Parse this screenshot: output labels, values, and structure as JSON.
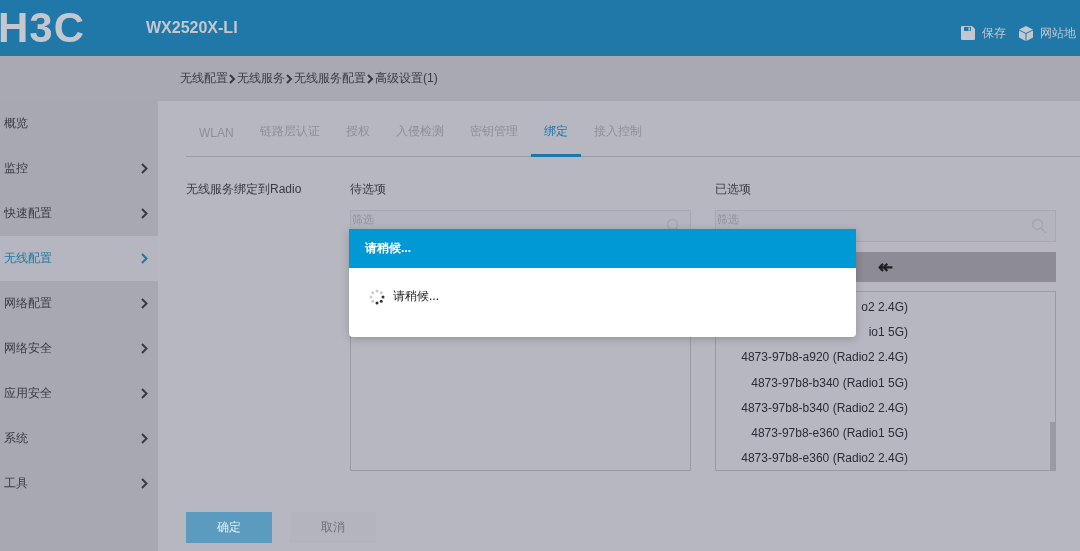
{
  "header": {
    "logo": "H3C",
    "model": "WX2520X-LI",
    "actions": [
      {
        "kind": "save",
        "label": "保存"
      },
      {
        "kind": "sitemap",
        "label": "网站地"
      }
    ]
  },
  "breadcrumb": [
    "无线配置",
    "无线服务",
    "无线服务配置",
    "高级设置(1)"
  ],
  "sidebar": {
    "items": [
      {
        "label": "概览",
        "expandable": false,
        "selected": false
      },
      {
        "label": "监控",
        "expandable": true,
        "selected": false
      },
      {
        "label": "快速配置",
        "expandable": true,
        "selected": false
      },
      {
        "label": "无线配置",
        "expandable": true,
        "selected": true
      },
      {
        "label": "网络配置",
        "expandable": true,
        "selected": false
      },
      {
        "label": "网络安全",
        "expandable": true,
        "selected": false
      },
      {
        "label": "应用安全",
        "expandable": true,
        "selected": false
      },
      {
        "label": "系统",
        "expandable": true,
        "selected": false
      },
      {
        "label": "工具",
        "expandable": true,
        "selected": false
      }
    ]
  },
  "tabs": [
    {
      "label": "WLAN",
      "selected": false
    },
    {
      "label": "链路层认证",
      "selected": false
    },
    {
      "label": "授权",
      "selected": false
    },
    {
      "label": "入侵检测",
      "selected": false
    },
    {
      "label": "密钥管理",
      "selected": false
    },
    {
      "label": "绑定",
      "selected": true
    },
    {
      "label": "接入控制",
      "selected": false
    }
  ],
  "form": {
    "label": "无线服务绑定到Radio",
    "available": {
      "title": "待选项",
      "placeholder": "筛选"
    },
    "selected": {
      "title": "已选项",
      "placeholder": "筛选",
      "move_button": "↞",
      "items": [
        "o2 2.4G)",
        "io1 5G)",
        "4873-97b8-a920 (Radio2 2.4G)",
        "4873-97b8-b340 (Radio1 5G)",
        "4873-97b8-b340 (Radio2 2.4G)",
        "4873-97b8-e360 (Radio1 5G)",
        "4873-97b8-e360 (Radio2 2.4G)"
      ]
    }
  },
  "buttons": [
    {
      "label": "确定",
      "kind": "primary"
    },
    {
      "label": "取消",
      "kind": "secondary"
    }
  ],
  "dialog": {
    "title": "请稍候...",
    "message": "请稍候..."
  }
}
